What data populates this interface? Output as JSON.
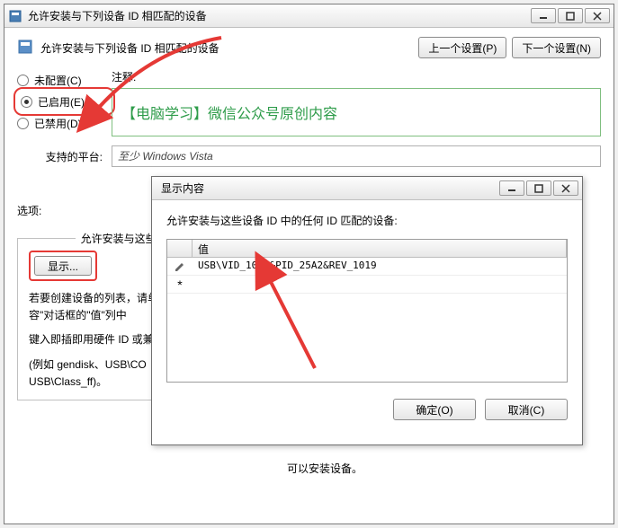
{
  "main_window": {
    "title": "允许安装与下列设备 ID 相匹配的设备",
    "section_title": "允许安装与下列设备 ID 相匹配的设备",
    "prev_button": "上一个设置(P)",
    "next_button": "下一个设置(N)",
    "comment_label": "注释:",
    "comment_text": "【电脑学习】微信公众号原创内容",
    "platform_label": "支持的平台:",
    "platform_value": "至少 Windows Vista",
    "radios": {
      "not_configured": "未配置(C)",
      "enabled": "已启用(E)",
      "disabled": "已禁用(D)"
    },
    "options_label": "选项:",
    "options_legend": "允许安装与这些设备 ID 相",
    "show_button": "显示...",
    "help_line1": "若要创建设备的列表，请单",
    "help_line2": "容\"对话框的\"值\"列中",
    "help_line3": "键入即插即用硬件 ID 或兼",
    "help_line4": "(例如 gendisk、USB\\CO",
    "help_line5": "USB\\Class_ff)。",
    "bottom_note": "可以安装设备。"
  },
  "dialog": {
    "title": "显示内容",
    "description": "允许安装与这些设备 ID 中的任何 ID 匹配的设备:",
    "value_header": "值",
    "rows": [
      {
        "icon": "pencil",
        "value": "USB\\VID_1058&PID_25A2&REV_1019"
      },
      {
        "icon": "asterisk",
        "value": ""
      }
    ],
    "ok_button": "确定(O)",
    "cancel_button": "取消(C)"
  }
}
